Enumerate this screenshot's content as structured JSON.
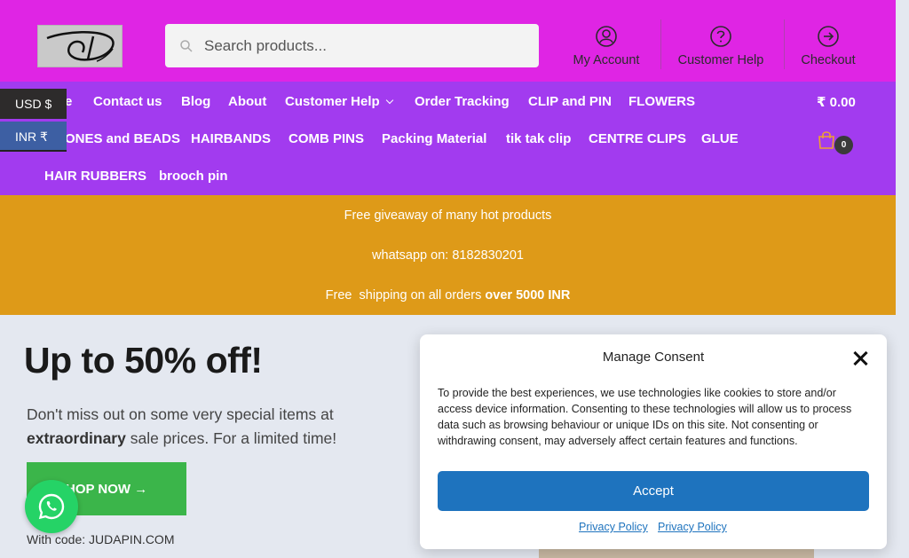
{
  "header": {
    "search_placeholder": "Search products...",
    "links": [
      {
        "label": "My Account",
        "icon": "user-circle-icon"
      },
      {
        "label": "Customer Help",
        "icon": "help-circle-icon"
      },
      {
        "label": "Checkout",
        "icon": "arrow-right-circle-icon"
      }
    ],
    "brand_color": "#df25e4"
  },
  "nav": {
    "row1": [
      "e",
      "Contact us",
      "Blog",
      "About",
      "Customer Help",
      "Order Tracking",
      "CLIP and PIN",
      "FLOWERS"
    ],
    "row2": [
      "ONES and BEADS",
      "HAIRBANDS",
      "COMB PINS",
      "Packing Material",
      "tik tak clip",
      "CENTRE CLIPS",
      "GLUE"
    ],
    "row3": [
      "HAIR RUBBERS",
      "brooch pin"
    ],
    "cart_total": "₹ 0.00",
    "cart_count": "0",
    "color": "#a23bef"
  },
  "currency": {
    "usd": "USD $",
    "inr": "INR ₹"
  },
  "promo": {
    "line1": "Free giveaway of many hot products",
    "line2": "whatsapp on: 8182830201",
    "line3_prefix": "Free  shipping on all orders ",
    "line3_bold": "over 5000 INR",
    "color": "#de9a18"
  },
  "hero": {
    "title": "Up to 50% off!",
    "desc_prefix": "Don't miss out on some very special items at ",
    "desc_bold": "extraordinary",
    "desc_suffix": " sale prices. For a limited time!",
    "button": "HOP NOW →",
    "code": "With code: JUDAPIN.COM"
  },
  "consent": {
    "title": "Manage Consent",
    "text": "To provide the best experiences, we use technologies like cookies to store and/or access device information. Consenting to these technologies will allow us to process data such as browsing behaviour or unique IDs on this site. Not consenting or withdrawing consent, may adversely affect certain features and functions.",
    "accept": "Accept",
    "link1": "Privacy Policy",
    "link2": "Privacy Policy"
  }
}
